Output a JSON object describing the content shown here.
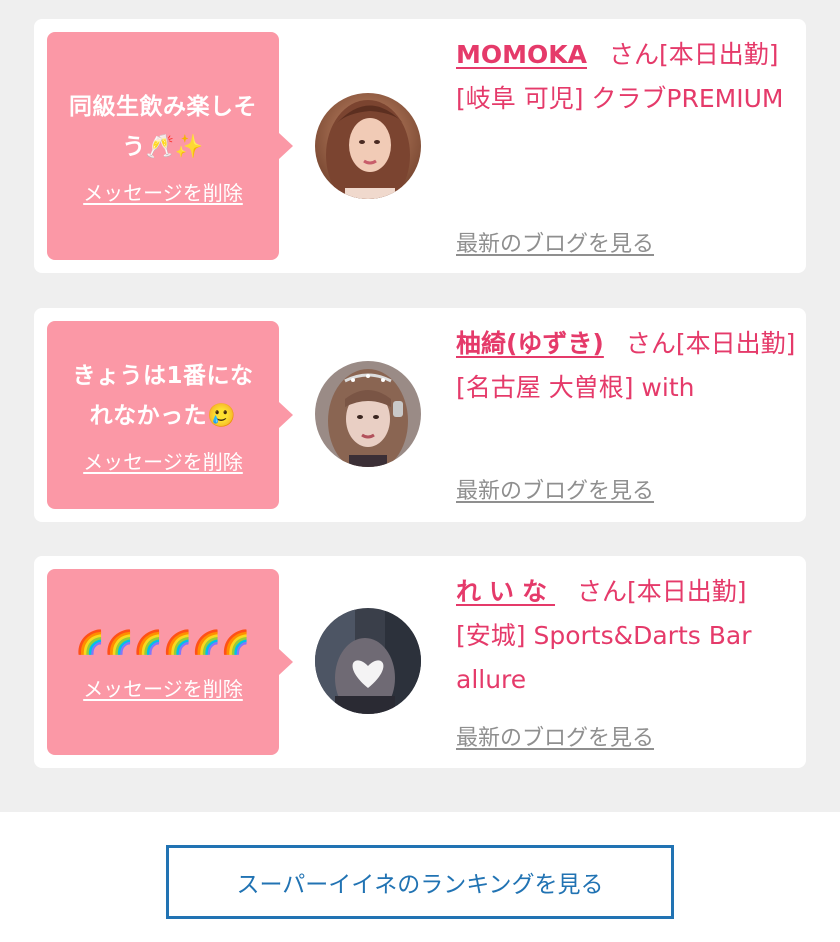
{
  "messages": [
    {
      "bubble_text": "同級生飲み楽しそう🥂✨",
      "delete_label": "メッセージを削除",
      "name": "MOMOKA",
      "suffix": "さん[本日出勤]",
      "area": "[岐阜 可児]",
      "shop": "クラブPREMIUM",
      "blog_label": "最新のブログを見る"
    },
    {
      "bubble_text": "きょうは1番になれなかった🥲",
      "delete_label": "メッセージを削除",
      "name": "柚綺(ゆずき)",
      "suffix": "さん[本日出勤]",
      "area": "[名古屋 大曽根]",
      "shop": "with",
      "blog_label": "最新のブログを見る"
    },
    {
      "bubble_text": "🌈🌈🌈🌈🌈🌈",
      "delete_label": "メッセージを削除",
      "name": "れいな",
      "suffix": "さん[本日出勤]",
      "area": "[安城]",
      "shop": "Sports&Darts Bar allure",
      "blog_label": "最新のブログを見る"
    }
  ],
  "ranking_button_label": "スーパーイイネのランキングを見る",
  "colors": {
    "bubble": "#fb98a6",
    "name": "#e53a6a",
    "link_gray": "#8f8f8f",
    "button_blue": "#2173b3",
    "feed_bg": "#efefef"
  }
}
